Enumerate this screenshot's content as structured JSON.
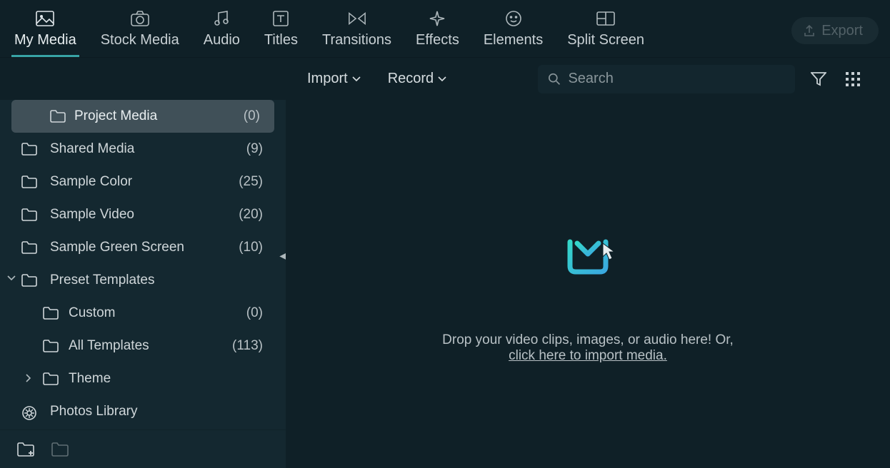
{
  "tabs": [
    {
      "label": "My Media"
    },
    {
      "label": "Stock Media"
    },
    {
      "label": "Audio"
    },
    {
      "label": "Titles"
    },
    {
      "label": "Transitions"
    },
    {
      "label": "Effects"
    },
    {
      "label": "Elements"
    },
    {
      "label": "Split Screen"
    }
  ],
  "export_label": "Export",
  "import_label": "Import",
  "record_label": "Record",
  "search_placeholder": "Search",
  "sidebar": [
    {
      "label": "Project Media",
      "count": "(0)"
    },
    {
      "label": "Shared Media",
      "count": "(9)"
    },
    {
      "label": "Sample Color",
      "count": "(25)"
    },
    {
      "label": "Sample Video",
      "count": "(20)"
    },
    {
      "label": "Sample Green Screen",
      "count": "(10)"
    },
    {
      "label": "Preset Templates"
    },
    {
      "label": "Custom",
      "count": "(0)"
    },
    {
      "label": "All Templates",
      "count": "(113)"
    },
    {
      "label": "Theme"
    },
    {
      "label": "Photos Library"
    }
  ],
  "dropzone": {
    "line1": "Drop your video clips, images, or audio here! Or,",
    "link": "click here to import media."
  }
}
